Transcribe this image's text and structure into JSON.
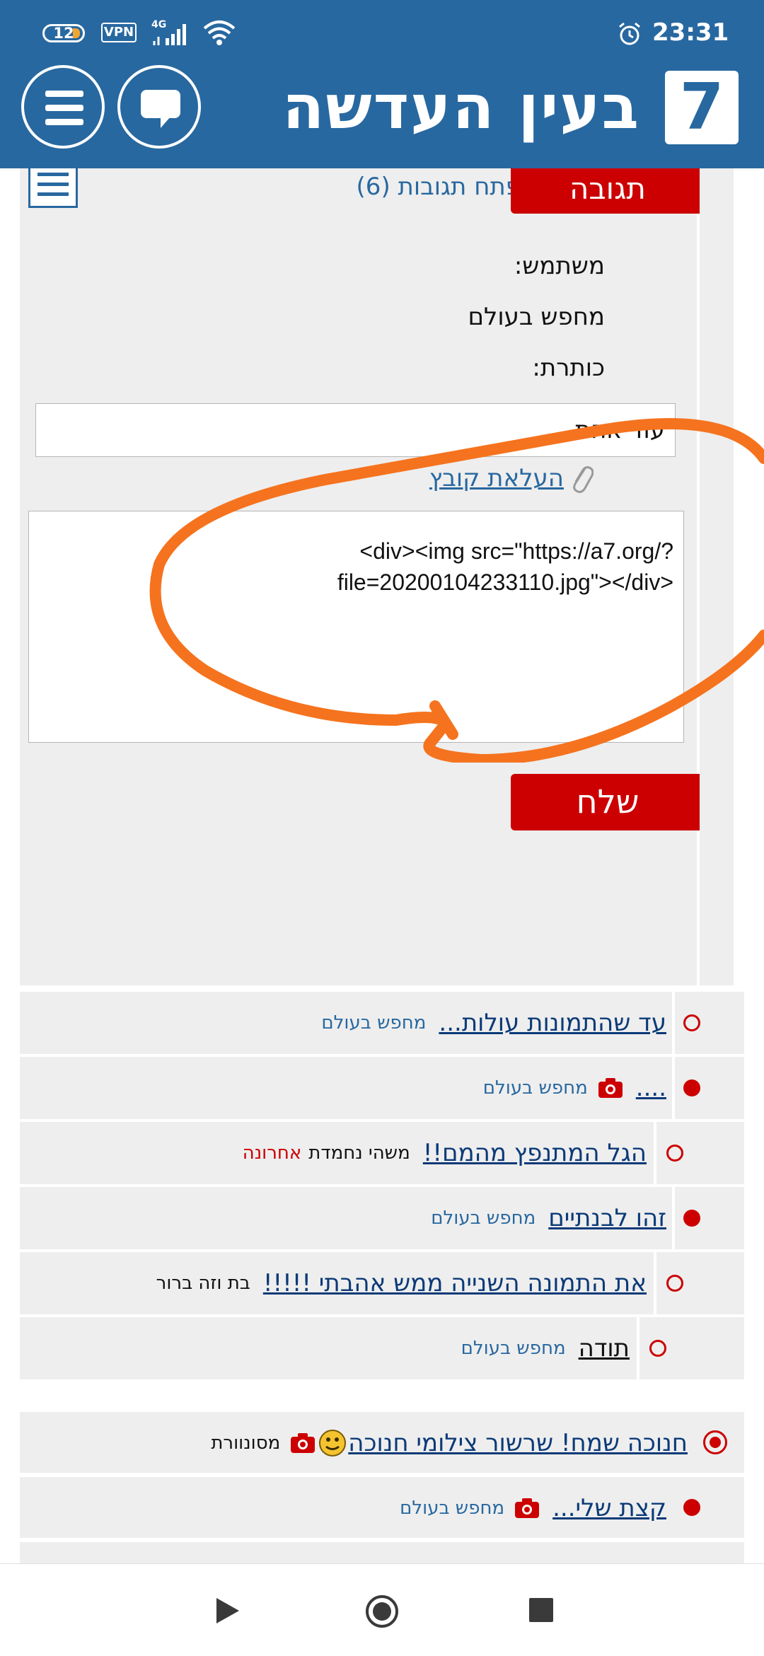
{
  "status_bar": {
    "battery": "12",
    "vpn": "VPN",
    "network": "4G",
    "time": "23:31"
  },
  "header": {
    "logo": "7",
    "site_title": "בעין העדשה",
    "icons": [
      "chat-bubble-icon",
      "hamburger-menu-icon"
    ]
  },
  "form": {
    "reply_label": "תגובה",
    "open_replies_label": "פתח תגובות (6)",
    "user_label": "משתמש:",
    "user_value": "מחפש בעולם",
    "title_label": "כותרת:",
    "title_value": "עוד אחת",
    "upload_label": "העלאת קובץ",
    "body_value": "<div><img src=\"https://a7.org/?\nfile=20200104233110.jpg\"></div>",
    "send_label": "שלח",
    "annotation_color": "#f5731e"
  },
  "threads": [
    {
      "title": "עד שהתמונות עולות...",
      "author": "מחפש בעולם",
      "dot": "empty",
      "camera": false
    },
    {
      "title": "....",
      "author": "מחפש בעולם",
      "dot": "full",
      "camera": true
    },
    {
      "title": "הגל המתנפץ מהמם!!",
      "author": "משהי נחמדת",
      "latest": "אחרונה",
      "dot": "empty",
      "camera": false
    },
    {
      "title": "זהו לבנתיים",
      "author": "מחפש בעולם",
      "dot": "full",
      "camera": false
    },
    {
      "title": "את התמונה השנייה ממש אהבתי !!!!!",
      "author": "בת וזה ברור",
      "dot": "empty",
      "camera": false
    },
    {
      "title": "תודה",
      "author": "מחפש בעולם",
      "dot": "empty",
      "camera": false
    }
  ],
  "threads2": [
    {
      "title": "חנוכה שמח! שרשור צילומי חנוכה",
      "author": "מסונוורת",
      "dot": "ring",
      "camera": true,
      "smiley": true
    },
    {
      "title": "קצת שלי...",
      "author": "מחפש בעולם",
      "dot": "full",
      "camera": true
    }
  ],
  "colors": {
    "brand": "#2868a0",
    "accent": "#cc0000",
    "panel": "#eeeeee"
  }
}
